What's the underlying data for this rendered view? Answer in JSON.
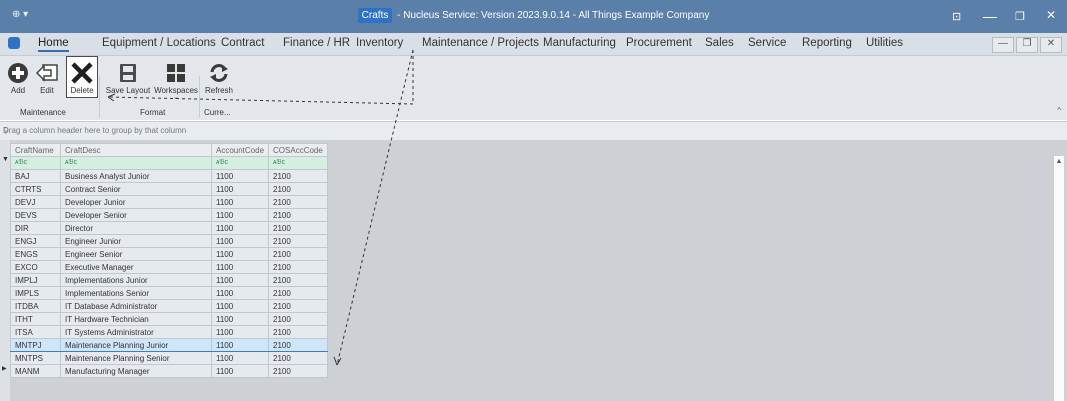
{
  "titlebar": {
    "app_glyph": "⊕ ▾",
    "badge": "Crafts",
    "title": " - Nucleus Service: Version 2023.9.0.14 - All Things Example Company",
    "buttons": [
      "⊡",
      "—",
      "❐",
      "✕"
    ]
  },
  "menu": {
    "items": [
      "Home",
      "Equipment / Locations",
      "Contract",
      "Finance / HR",
      "Inventory",
      "Maintenance / Projects",
      "Manufacturing",
      "Procurement",
      "Sales",
      "Service",
      "Reporting",
      "Utilities"
    ],
    "active": "Home",
    "mdi_buttons": [
      "—",
      "❐",
      "✕"
    ]
  },
  "ribbon": {
    "buttons": [
      {
        "label": "Add",
        "icon": "add-icon"
      },
      {
        "label": "Edit",
        "icon": "edit-icon"
      },
      {
        "label": "Delete",
        "icon": "delete-icon"
      },
      {
        "label": "Save Layout",
        "icon": "save-layout-icon"
      },
      {
        "label": "Workspaces",
        "icon": "workspaces-icon"
      },
      {
        "label": "Refresh",
        "icon": "refresh-icon"
      }
    ],
    "groups": [
      "Maintenance",
      "Format",
      "Curre..."
    ]
  },
  "groupbar": {
    "hint": "Drag a column header here to group by that column"
  },
  "grid": {
    "columns": [
      "CraftName",
      "CraftDesc",
      "AccountCode",
      "COSAccCode"
    ],
    "filter_glyph": "ᴀ𝔅ᴄ",
    "rows": [
      [
        "BAJ",
        "Business Analyst Junior",
        "1100",
        "2100"
      ],
      [
        "CTRTS",
        "Contract Senior",
        "1100",
        "2100"
      ],
      [
        "DEVJ",
        "Developer Junior",
        "1100",
        "2100"
      ],
      [
        "DEVS",
        "Developer Senior",
        "1100",
        "2100"
      ],
      [
        "DIR",
        "Director",
        "1100",
        "2100"
      ],
      [
        "ENGJ",
        "Engineer Junior",
        "1100",
        "2100"
      ],
      [
        "ENGS",
        "Engineer Senior",
        "1100",
        "2100"
      ],
      [
        "EXCO",
        "Executive Manager",
        "1100",
        "2100"
      ],
      [
        "IMPLJ",
        "Implementations Junior",
        "1100",
        "2100"
      ],
      [
        "IMPLS",
        "Implementations Senior",
        "1100",
        "2100"
      ],
      [
        "ITDBA",
        "IT Database Administrator",
        "1100",
        "2100"
      ],
      [
        "ITHT",
        "IT Hardware Technician",
        "1100",
        "2100"
      ],
      [
        "ITSA",
        "IT Systems Administrator",
        "1100",
        "2100"
      ],
      [
        "MNTPJ",
        "Maintenance Planning Junior",
        "1100",
        "2100"
      ],
      [
        "MNTPS",
        "Maintenance Planning Senior",
        "1100",
        "2100"
      ],
      [
        "MANM",
        "Manufacturing Manager",
        "1100",
        "2100"
      ]
    ],
    "selected_row": 13
  },
  "colors": {
    "accent": "#2f72c4",
    "titlebar": "#5a7fa8",
    "selection": "#cfe6fa",
    "filter_row": "#d4efe0",
    "annotation": "#333333"
  }
}
